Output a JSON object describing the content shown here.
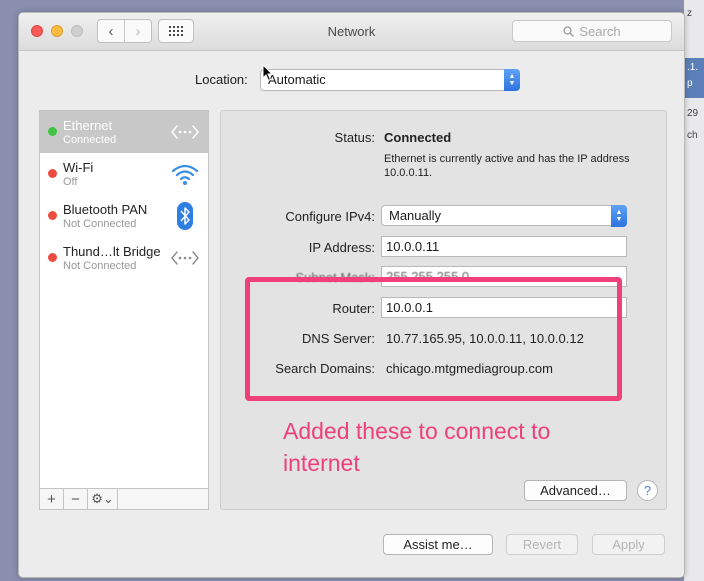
{
  "background": {
    "labels": [
      "z",
      ".1.",
      "p",
      "29",
      "ch"
    ]
  },
  "window": {
    "title": "Network",
    "nav": {
      "back": "‹",
      "forward": "›"
    },
    "search_placeholder": "Search"
  },
  "location": {
    "label": "Location:",
    "value": "Automatic"
  },
  "services": [
    {
      "name": "Ethernet",
      "status": "Connected",
      "state": "connected",
      "selected": true,
      "icon": "ethernet-arrows-icon"
    },
    {
      "name": "Wi-Fi",
      "status": "Off",
      "state": "off",
      "selected": false,
      "icon": "wifi-icon"
    },
    {
      "name": "Bluetooth PAN",
      "status": "Not Connected",
      "state": "off",
      "selected": false,
      "icon": "bluetooth-icon"
    },
    {
      "name": "Thund…lt Bridge",
      "status": "Not Connected",
      "state": "off",
      "selected": false,
      "icon": "thunderbolt-arrows-icon"
    }
  ],
  "sidebar_toolbar": {
    "add": "+",
    "remove": "−",
    "action": "⚙︎⌄"
  },
  "detail": {
    "status_label": "Status:",
    "status_value": "Connected",
    "status_description": "Ethernet is currently active and has the IP address 10.0.0.11.",
    "configure_label": "Configure IPv4:",
    "configure_value": "Manually",
    "ip_label": "IP Address:",
    "ip_value": "10.0.0.11",
    "subnet_label": "Subnet Mask:",
    "subnet_value": "255.255.255.0",
    "router_label": "Router:",
    "router_value": "10.0.0.1",
    "dns_label": "DNS Server:",
    "dns_value": "10.77.165.95, 10.0.0.11, 10.0.0.12",
    "domains_label": "Search Domains:",
    "domains_value": "chicago.mtgmediagroup.com"
  },
  "buttons": {
    "advanced": "Advanced…",
    "help": "?",
    "assist": "Assist me…",
    "revert": "Revert",
    "apply": "Apply"
  },
  "annotation": {
    "text": "Added these to connect to internet",
    "color": "#f0407a"
  },
  "colors": {
    "connected": "#3ec440",
    "disconnected": "#ec4b40",
    "accent": "#2d74e0"
  }
}
